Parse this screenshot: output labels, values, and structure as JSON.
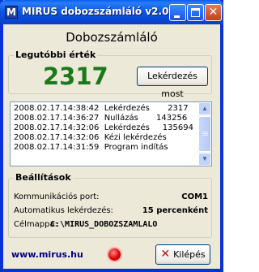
{
  "window": {
    "title": "MIRUS dobozszámláló v2.0",
    "app_icon_letter": "M"
  },
  "heading": "Dobozszámláló",
  "last_value": {
    "label": "Legutóbbi érték",
    "value": "2317",
    "value_color": "#1a7a1a",
    "query_button": "Lekérdezés most"
  },
  "log": [
    "2008.02.17.14:38:42  Lekérdezés       2317",
    "2008.02.17.14:36:27  Nullázás       143256",
    "2008.02.17.14:32:06  Lekérdezés     135694",
    "2008.02.17.14:32:06  Kézi lekérdezés",
    "2008.02.17.14:31:59  Program indítás"
  ],
  "settings": {
    "label": "Beállítások",
    "port_label": "Kommunikációs port:",
    "port_value": "COM1",
    "auto_label": "Automatikus lekérdezés:",
    "auto_value": "15 percenként",
    "folder_label": "Célmappa:",
    "folder_value": "C:\\MIRUS_DOBOZSZAMLALO"
  },
  "footer": {
    "link": "www.mirus.hu",
    "status_color": "#e00000",
    "exit_button": "Kilépés"
  }
}
